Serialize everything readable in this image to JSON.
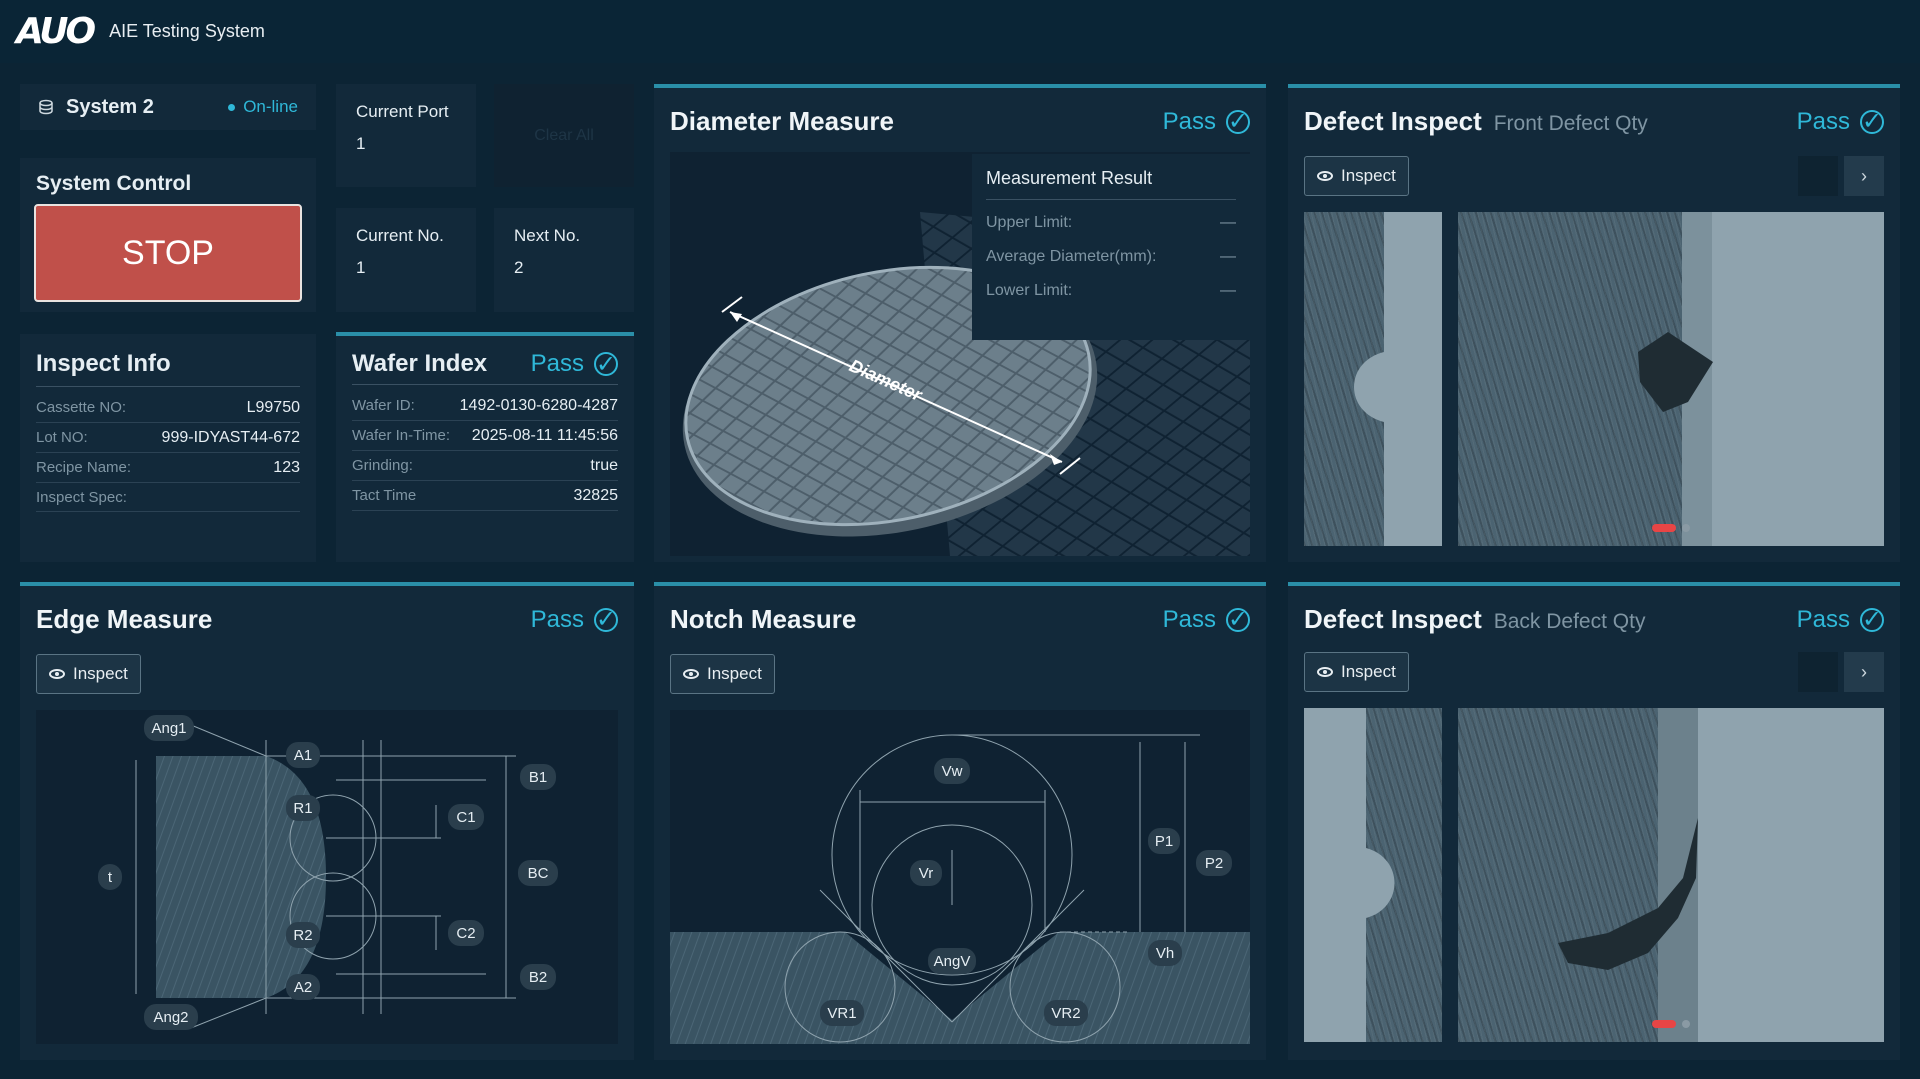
{
  "header": {
    "logo": "AUO",
    "title": "AIE Testing System"
  },
  "system": {
    "name": "System 2",
    "status": "On-line"
  },
  "control": {
    "title": "System Control",
    "stop_label": "STOP"
  },
  "ports": {
    "current_port_label": "Current Port",
    "current_port_value": "1",
    "clear_all_label": "Clear All",
    "current_no_label": "Current No.",
    "current_no_value": "1",
    "next_no_label": "Next No.",
    "next_no_value": "2"
  },
  "inspect_info": {
    "title": "Inspect Info",
    "rows": [
      {
        "k": "Cassette NO:",
        "v": "L99750"
      },
      {
        "k": "Lot NO:",
        "v": "999-IDYAST44-672"
      },
      {
        "k": "Recipe Name:",
        "v": "123"
      },
      {
        "k": "Inspect Spec:",
        "v": ""
      }
    ]
  },
  "wafer_index": {
    "title": "Wafer Index",
    "status": "Pass",
    "rows": [
      {
        "k": "Wafer ID:",
        "v": "1492-0130-6280-4287"
      },
      {
        "k": "Wafer In-Time:",
        "v": "2025-08-11 11:45:56"
      },
      {
        "k": "Grinding:",
        "v": "true"
      },
      {
        "k": "Tact Time",
        "v": "32825"
      }
    ]
  },
  "diameter": {
    "title": "Diameter Measure",
    "status": "Pass",
    "arrow_label": "Diameter",
    "result_title": "Measurement Result",
    "rows": [
      {
        "k": "Upper Limit:",
        "v": "—"
      },
      {
        "k": "Average Diameter(mm):",
        "v": "—"
      },
      {
        "k": "Lower Limit:",
        "v": "—"
      }
    ]
  },
  "defect_front": {
    "title": "Defect Inspect",
    "subtitle": "Front Defect Qty",
    "status": "Pass",
    "inspect_label": "Inspect",
    "next_icon": "chevron-right"
  },
  "defect_back": {
    "title": "Defect Inspect",
    "subtitle": "Back Defect Qty",
    "status": "Pass",
    "inspect_label": "Inspect",
    "next_icon": "chevron-right"
  },
  "edge": {
    "title": "Edge Measure",
    "status": "Pass",
    "inspect_label": "Inspect",
    "labels": {
      "ang1": "Ang1",
      "a1": "A1",
      "b1": "B1",
      "r1": "R1",
      "c1": "C1",
      "t": "t",
      "bc": "BC",
      "r2": "R2",
      "c2": "C2",
      "a2": "A2",
      "b2": "B2",
      "ang2": "Ang2"
    }
  },
  "notch": {
    "title": "Notch Measure",
    "status": "Pass",
    "inspect_label": "Inspect",
    "labels": {
      "vw": "Vw",
      "vr": "Vr",
      "p1": "P1",
      "p2": "P2",
      "vh": "Vh",
      "angv": "AngV",
      "vr1": "VR1",
      "vr2": "VR2"
    }
  },
  "colors": {
    "accent": "#2fb8d8",
    "stop": "#c0504a",
    "background": "#0c2434",
    "card": "#12293a"
  }
}
